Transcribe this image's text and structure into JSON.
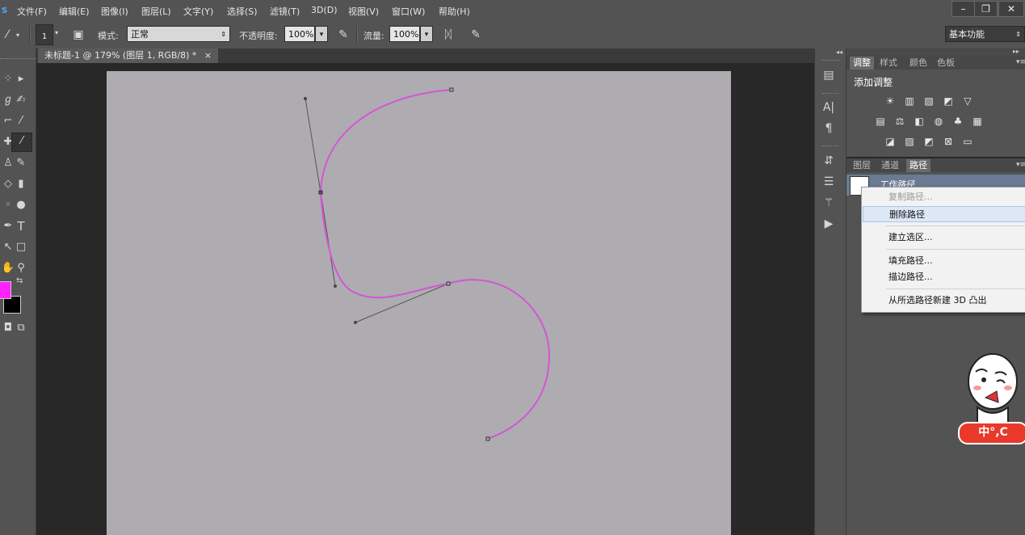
{
  "menubar": {
    "items": [
      "文件(F)",
      "编辑(E)",
      "图像(I)",
      "图层(L)",
      "文字(Y)",
      "选择(S)",
      "滤镜(T)",
      "3D(D)",
      "视图(V)",
      "窗口(W)",
      "帮助(H)"
    ],
    "window_buttons": [
      "–",
      "❐",
      "✕"
    ]
  },
  "options": {
    "brush_size": "1",
    "mode_label": "模式:",
    "mode_value": "正常",
    "opacity_label": "不透明度:",
    "opacity_value": "100%",
    "flow_label": "流量:",
    "flow_value": "100%",
    "workspace": "基本功能"
  },
  "document": {
    "tab_title": "未标题-1 @ 179% (图层 1, RGB/8) *",
    "close_glyph": "×"
  },
  "adjust_panel": {
    "tabs": [
      "调整",
      "样式",
      "颜色",
      "色板"
    ],
    "active_tab": "调整",
    "title": "添加调整"
  },
  "paths_panel": {
    "tabs": [
      "图层",
      "通道",
      "路径"
    ],
    "active_tab": "路径",
    "path_name": "工作路径"
  },
  "context_menu": {
    "items": [
      {
        "label": "复制路径...",
        "state": "disabled"
      },
      {
        "label": "删除路径",
        "state": "hover"
      },
      {
        "label": "建立选区...",
        "state": "normal"
      },
      {
        "label": "填充路径...",
        "state": "normal"
      },
      {
        "label": "描边路径...",
        "state": "normal"
      },
      {
        "label": "从所选路径新建 3D 凸出",
        "state": "normal"
      }
    ]
  },
  "colors": {
    "foreground": "#ff22ff",
    "background": "#000000",
    "path_stroke": "#d455d4",
    "canvas": "#aeacb0"
  },
  "mascot": {
    "text": "中°,C"
  }
}
